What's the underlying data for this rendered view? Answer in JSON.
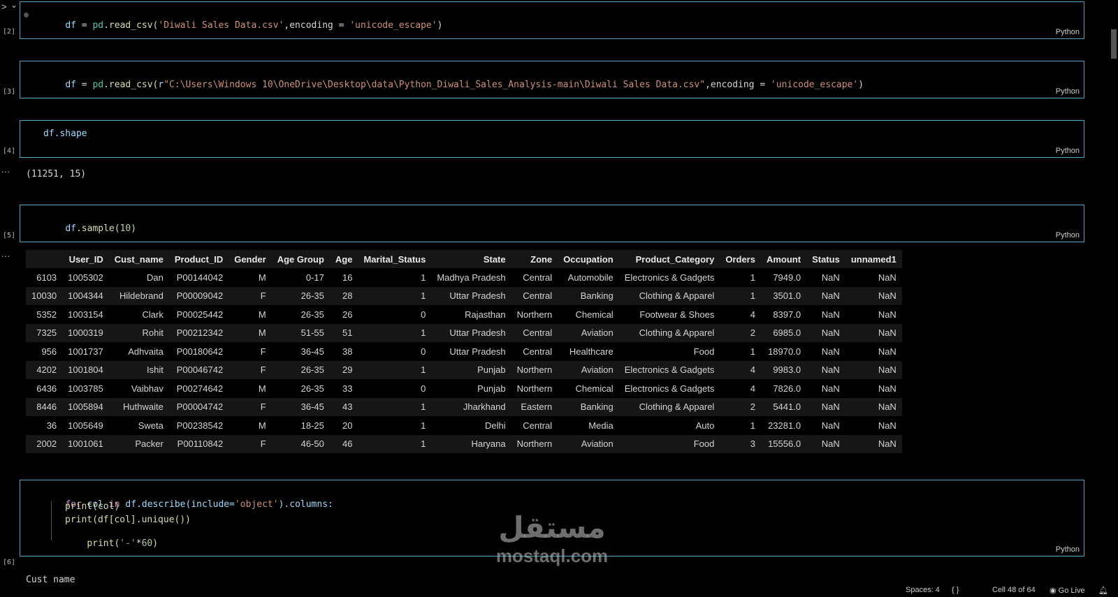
{
  "toolbar": {
    "run_chevron": ">",
    "expand_chevron": "⌄"
  },
  "cells": [
    {
      "exec_count": "[2]",
      "language": "Python"
    },
    {
      "exec_count": "[3]",
      "language": "Python"
    },
    {
      "exec_count": "[4]",
      "language": "Python",
      "output": "(11251, 15)"
    },
    {
      "exec_count": "[5]",
      "language": "Python"
    },
    {
      "exec_count": "[6]",
      "language": "Python"
    }
  ],
  "code": {
    "c2": {
      "df": "df",
      "eq": " = ",
      "pd": "pd",
      "fn": ".read_csv(",
      "path": "'Diwali Sales Data.csv'",
      "enc": ",encoding = ",
      "encval": "'unicode_escape'",
      "close": ")"
    },
    "c3": {
      "df": "df",
      "eq": " = ",
      "pd": "pd",
      "fn": ".read_csv(",
      "r": "r",
      "path": "\"C:\\Users\\Windows 10\\OneDrive\\Desktop\\data\\Python_Diwali_Sales_Analysis-main\\Diwali Sales Data.csv\"",
      "enc": ",encoding = ",
      "encval": "'unicode_escape'",
      "close": ")"
    },
    "c4": {
      "text": "df.shape"
    },
    "c5": {
      "df": "df",
      "fn": ".sample(",
      "arg": "10",
      "close": ")"
    },
    "c6": {
      "l1_for": "for",
      "l1_col": " col ",
      "l1_in": "in",
      "l1_rest": " df.describe(include=",
      "l1_str": "'object'",
      "l1_end": ").columns:",
      "l2": "print(col)",
      "l3": "print(df[col].unique())",
      "l4_a": "print(",
      "l4_str": "'-'",
      "l4_b": "*",
      "l4_num": "60",
      "l4_c": ")"
    }
  },
  "output_ellipsis": "...",
  "table": {
    "columns": [
      "",
      "User_ID",
      "Cust_name",
      "Product_ID",
      "Gender",
      "Age Group",
      "Age",
      "Marital_Status",
      "State",
      "Zone",
      "Occupation",
      "Product_Category",
      "Orders",
      "Amount",
      "Status",
      "unnamed1"
    ],
    "rows": [
      [
        "6103",
        "1005302",
        "Dan",
        "P00144042",
        "M",
        "0-17",
        "16",
        "1",
        "Madhya Pradesh",
        "Central",
        "Automobile",
        "Electronics & Gadgets",
        "1",
        "7949.0",
        "NaN",
        "NaN"
      ],
      [
        "10030",
        "1004344",
        "Hildebrand",
        "P00009042",
        "F",
        "26-35",
        "28",
        "1",
        "Uttar Pradesh",
        "Central",
        "Banking",
        "Clothing & Apparel",
        "1",
        "3501.0",
        "NaN",
        "NaN"
      ],
      [
        "5352",
        "1003154",
        "Clark",
        "P00025442",
        "M",
        "26-35",
        "26",
        "0",
        "Rajasthan",
        "Northern",
        "Chemical",
        "Footwear & Shoes",
        "4",
        "8397.0",
        "NaN",
        "NaN"
      ],
      [
        "7325",
        "1000319",
        "Rohit",
        "P00212342",
        "M",
        "51-55",
        "51",
        "1",
        "Uttar Pradesh",
        "Central",
        "Aviation",
        "Clothing & Apparel",
        "2",
        "6985.0",
        "NaN",
        "NaN"
      ],
      [
        "956",
        "1001737",
        "Adhvaita",
        "P00180642",
        "F",
        "36-45",
        "38",
        "0",
        "Uttar Pradesh",
        "Central",
        "Healthcare",
        "Food",
        "1",
        "18970.0",
        "NaN",
        "NaN"
      ],
      [
        "4202",
        "1001804",
        "Ishit",
        "P00046742",
        "F",
        "26-35",
        "29",
        "1",
        "Punjab",
        "Northern",
        "Aviation",
        "Electronics & Gadgets",
        "4",
        "9983.0",
        "NaN",
        "NaN"
      ],
      [
        "6436",
        "1003785",
        "Vaibhav",
        "P00274642",
        "M",
        "26-35",
        "33",
        "0",
        "Punjab",
        "Northern",
        "Chemical",
        "Electronics & Gadgets",
        "4",
        "7826.0",
        "NaN",
        "NaN"
      ],
      [
        "8446",
        "1005894",
        "Huthwaite",
        "P00004742",
        "F",
        "36-45",
        "43",
        "1",
        "Jharkhand",
        "Eastern",
        "Banking",
        "Clothing & Apparel",
        "2",
        "5441.0",
        "NaN",
        "NaN"
      ],
      [
        "36",
        "1005649",
        "Sweta",
        "P00238542",
        "M",
        "18-25",
        "20",
        "1",
        "Delhi",
        "Central",
        "Media",
        "Auto",
        "1",
        "23281.0",
        "NaN",
        "NaN"
      ],
      [
        "2002",
        "1001061",
        "Packer",
        "P00110842",
        "F",
        "46-50",
        "46",
        "1",
        "Haryana",
        "Northern",
        "Aviation",
        "Food",
        "3",
        "15556.0",
        "NaN",
        "NaN"
      ]
    ]
  },
  "partial_output": "Cust_name",
  "watermark": {
    "logo": "مستقل",
    "sub": "mostaql.com"
  },
  "statusbar": {
    "spaces": "Spaces: 4",
    "braces": "{ }",
    "cell": "Cell 48 of 64",
    "golive": "Go Live"
  },
  "colors": {
    "cell_border": "#4fa3c7",
    "background": "#000000"
  }
}
